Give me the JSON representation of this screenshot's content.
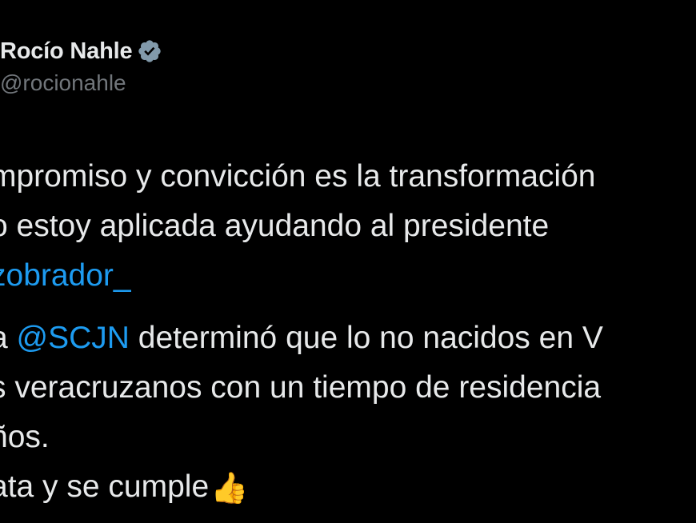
{
  "author": {
    "display_name": "Rocío Nahle",
    "handle": "@rocionahle",
    "verified_icon": "verified-badge-icon"
  },
  "tweet": {
    "line1": "mpromiso y convicción es la transformación",
    "line2": "o estoy aplicada ayudando al presidente",
    "line3_mention": "zobrador_",
    "line4_prefix": "a ",
    "line4_mention": "@SCJN",
    "line4_suffix": " determinó que lo no nacidos en V",
    "line5": "s veracruzanos con un tiempo de residencia",
    "line6": "ños.",
    "line7": "ata y se cumple",
    "line7_emoji": "👍"
  },
  "colors": {
    "background": "#000000",
    "text": "#e7e9ea",
    "secondary_text": "#71767b",
    "link": "#1d9bf0",
    "verified": "#829aab"
  }
}
